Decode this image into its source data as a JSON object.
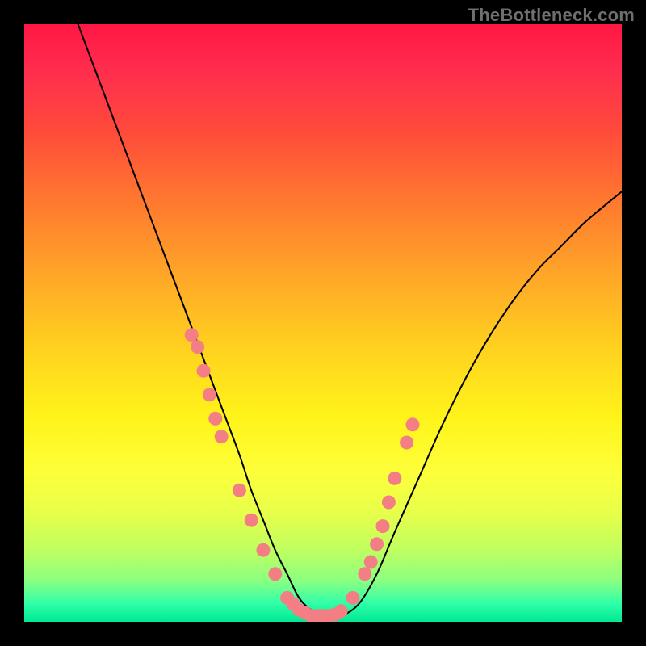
{
  "watermark": {
    "text": "TheBottleneck.com"
  },
  "chart_data": {
    "type": "line",
    "title": "",
    "xlabel": "",
    "ylabel": "",
    "xlim": [
      0,
      100
    ],
    "ylim": [
      0,
      100
    ],
    "grid": false,
    "legend": false,
    "series": [
      {
        "name": "curve",
        "x": [
          9,
          12,
          15,
          18,
          21,
          24,
          27,
          30,
          33,
          36,
          38,
          40,
          42,
          44,
          46,
          48,
          50,
          53,
          56,
          59,
          62,
          66,
          70,
          74,
          78,
          82,
          86,
          90,
          94,
          100
        ],
        "values": [
          100,
          92,
          84,
          76,
          68,
          60,
          52,
          44,
          36,
          28,
          22,
          17,
          12,
          8,
          4,
          2,
          1,
          1,
          3,
          8,
          15,
          24,
          33,
          41,
          48,
          54,
          59,
          63,
          67,
          72
        ]
      }
    ],
    "highlight_points": {
      "name": "markers",
      "color": "#f37f84",
      "x": [
        28,
        29,
        30,
        31,
        32,
        33,
        36,
        38,
        40,
        42,
        44,
        45,
        46,
        47,
        48,
        49,
        50,
        51,
        52,
        53,
        55,
        57,
        58,
        59,
        60,
        61,
        62,
        64,
        65
      ],
      "values": [
        48,
        46,
        42,
        38,
        34,
        31,
        22,
        17,
        12,
        8,
        4,
        3,
        2,
        1.5,
        1,
        1,
        1,
        1,
        1.2,
        1.8,
        4,
        8,
        10,
        13,
        16,
        20,
        24,
        30,
        33
      ]
    }
  }
}
